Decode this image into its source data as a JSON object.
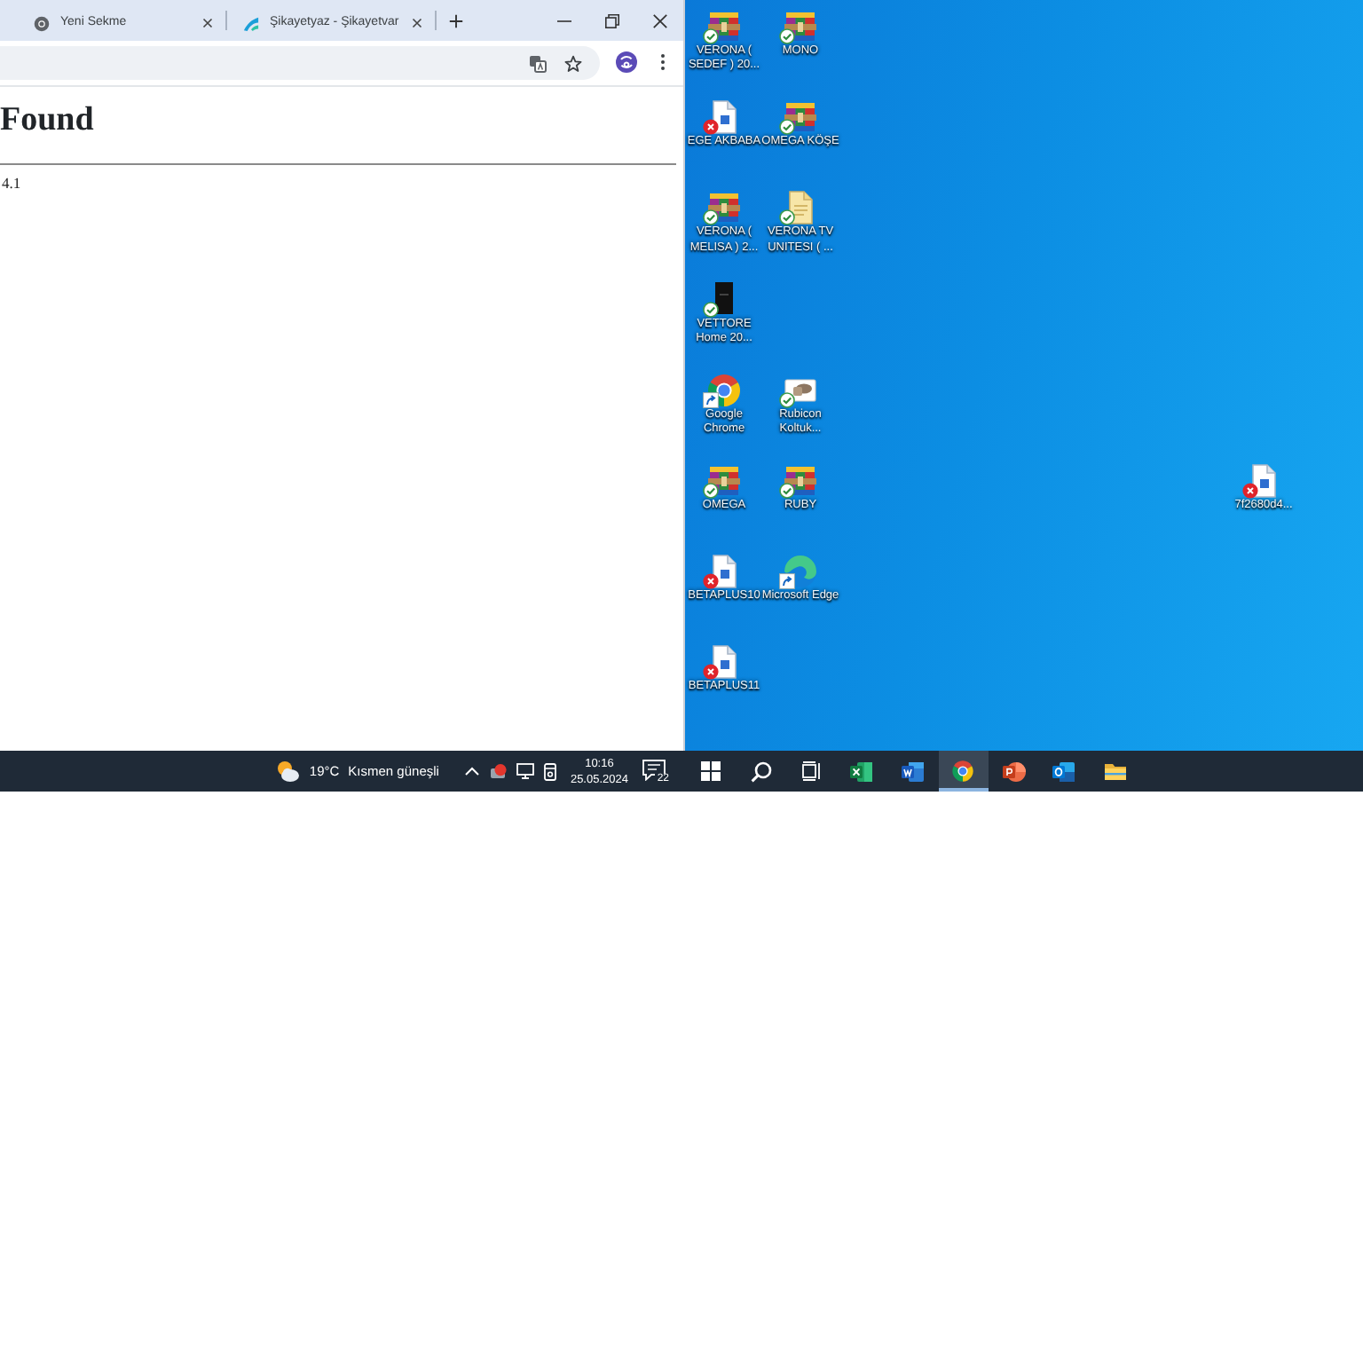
{
  "browser": {
    "tabs": [
      {
        "kind": "new-tab",
        "title": "Yeni Sekme",
        "selected": false
      },
      {
        "kind": "site",
        "title": "Şikayetyaz - Şikayetvar",
        "selected": false
      }
    ],
    "page": {
      "heading": "Found",
      "text": "4.1"
    }
  },
  "left_taskbar": {
    "weather": {
      "temperature": "19°C",
      "condition": "Kısmen güneşli"
    },
    "clock": {
      "time": "10:16",
      "date": "25.05.2024"
    },
    "notification_count": "22"
  },
  "desktop": {
    "icons": [
      {
        "label": "VERONA ( SEDEF ) 20...",
        "kind": "archive",
        "synced": true,
        "sync_error": false,
        "shortcut": false
      },
      {
        "label": "MONO",
        "kind": "archive",
        "synced": true,
        "sync_error": false,
        "shortcut": false
      },
      {
        "label": "EGE AKBABA",
        "kind": "document",
        "synced": false,
        "sync_error": true,
        "shortcut": false
      },
      {
        "label": "OMEGA KÖŞE",
        "kind": "archive",
        "synced": true,
        "sync_error": false,
        "shortcut": false
      },
      {
        "label": "VERONA ( MELISA ) 2...",
        "kind": "archive",
        "synced": true,
        "sync_error": false,
        "shortcut": false
      },
      {
        "label": "VERONA TV UNITESI ( ...",
        "kind": "note",
        "synced": true,
        "sync_error": false,
        "shortcut": false
      },
      {
        "label": "VETTORE Home 20...",
        "kind": "video",
        "synced": true,
        "sync_error": false,
        "shortcut": false
      },
      {
        "label": "Google Chrome",
        "kind": "chrome",
        "synced": false,
        "sync_error": false,
        "shortcut": true
      },
      {
        "label": "Rubicon Koltuk...",
        "kind": "image",
        "synced": true,
        "sync_error": false,
        "shortcut": false
      },
      {
        "label": "OMEGA",
        "kind": "archive",
        "synced": true,
        "sync_error": false,
        "shortcut": false
      },
      {
        "label": "RUBY",
        "kind": "archive",
        "synced": true,
        "sync_error": false,
        "shortcut": false
      },
      {
        "label": "7f2680d4...",
        "kind": "document",
        "synced": false,
        "sync_error": true,
        "shortcut": false
      },
      {
        "label": "BETAPLUS10",
        "kind": "document",
        "synced": false,
        "sync_error": true,
        "shortcut": false
      },
      {
        "label": "Microsoft Edge",
        "kind": "edge",
        "synced": false,
        "sync_error": false,
        "shortcut": true
      },
      {
        "label": "BETAPLUS11",
        "kind": "document",
        "synced": false,
        "sync_error": true,
        "shortcut": false
      }
    ]
  },
  "right_taskbar": {
    "apps": [
      {
        "kind": "start",
        "selected": false
      },
      {
        "kind": "search",
        "selected": false
      },
      {
        "kind": "task-view",
        "selected": false
      },
      {
        "kind": "excel",
        "selected": false
      },
      {
        "kind": "word",
        "selected": false
      },
      {
        "kind": "chrome",
        "selected": true
      },
      {
        "kind": "powerpoint",
        "selected": false
      },
      {
        "kind": "outlook",
        "selected": false
      },
      {
        "kind": "explorer",
        "selected": false
      }
    ]
  }
}
